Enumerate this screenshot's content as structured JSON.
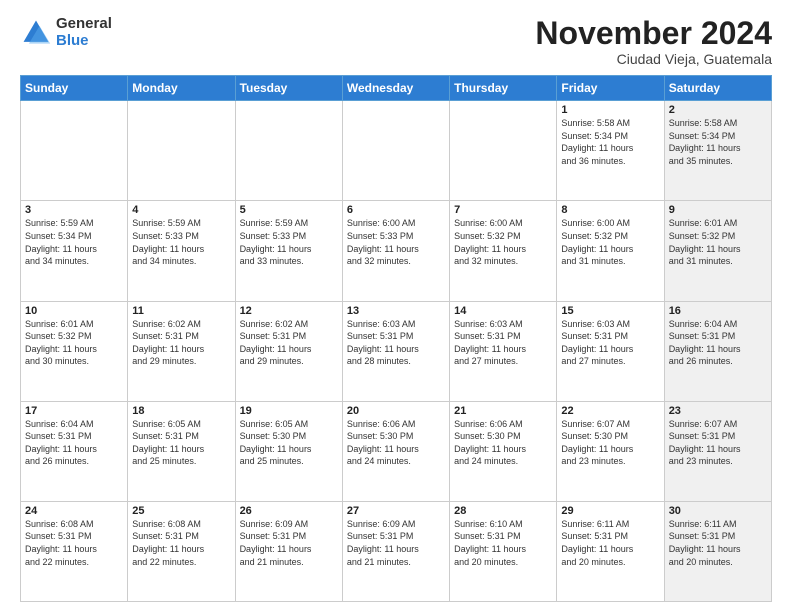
{
  "logo": {
    "general": "General",
    "blue": "Blue"
  },
  "header": {
    "month": "November 2024",
    "location": "Ciudad Vieja, Guatemala"
  },
  "weekdays": [
    "Sunday",
    "Monday",
    "Tuesday",
    "Wednesday",
    "Thursday",
    "Friday",
    "Saturday"
  ],
  "weeks": [
    [
      {
        "day": "",
        "info": "",
        "shaded": false
      },
      {
        "day": "",
        "info": "",
        "shaded": false
      },
      {
        "day": "",
        "info": "",
        "shaded": false
      },
      {
        "day": "",
        "info": "",
        "shaded": false
      },
      {
        "day": "",
        "info": "",
        "shaded": false
      },
      {
        "day": "1",
        "info": "Sunrise: 5:58 AM\nSunset: 5:34 PM\nDaylight: 11 hours\nand 36 minutes.",
        "shaded": false
      },
      {
        "day": "2",
        "info": "Sunrise: 5:58 AM\nSunset: 5:34 PM\nDaylight: 11 hours\nand 35 minutes.",
        "shaded": true
      }
    ],
    [
      {
        "day": "3",
        "info": "Sunrise: 5:59 AM\nSunset: 5:34 PM\nDaylight: 11 hours\nand 34 minutes.",
        "shaded": false
      },
      {
        "day": "4",
        "info": "Sunrise: 5:59 AM\nSunset: 5:33 PM\nDaylight: 11 hours\nand 34 minutes.",
        "shaded": false
      },
      {
        "day": "5",
        "info": "Sunrise: 5:59 AM\nSunset: 5:33 PM\nDaylight: 11 hours\nand 33 minutes.",
        "shaded": false
      },
      {
        "day": "6",
        "info": "Sunrise: 6:00 AM\nSunset: 5:33 PM\nDaylight: 11 hours\nand 32 minutes.",
        "shaded": false
      },
      {
        "day": "7",
        "info": "Sunrise: 6:00 AM\nSunset: 5:32 PM\nDaylight: 11 hours\nand 32 minutes.",
        "shaded": false
      },
      {
        "day": "8",
        "info": "Sunrise: 6:00 AM\nSunset: 5:32 PM\nDaylight: 11 hours\nand 31 minutes.",
        "shaded": false
      },
      {
        "day": "9",
        "info": "Sunrise: 6:01 AM\nSunset: 5:32 PM\nDaylight: 11 hours\nand 31 minutes.",
        "shaded": true
      }
    ],
    [
      {
        "day": "10",
        "info": "Sunrise: 6:01 AM\nSunset: 5:32 PM\nDaylight: 11 hours\nand 30 minutes.",
        "shaded": false
      },
      {
        "day": "11",
        "info": "Sunrise: 6:02 AM\nSunset: 5:31 PM\nDaylight: 11 hours\nand 29 minutes.",
        "shaded": false
      },
      {
        "day": "12",
        "info": "Sunrise: 6:02 AM\nSunset: 5:31 PM\nDaylight: 11 hours\nand 29 minutes.",
        "shaded": false
      },
      {
        "day": "13",
        "info": "Sunrise: 6:03 AM\nSunset: 5:31 PM\nDaylight: 11 hours\nand 28 minutes.",
        "shaded": false
      },
      {
        "day": "14",
        "info": "Sunrise: 6:03 AM\nSunset: 5:31 PM\nDaylight: 11 hours\nand 27 minutes.",
        "shaded": false
      },
      {
        "day": "15",
        "info": "Sunrise: 6:03 AM\nSunset: 5:31 PM\nDaylight: 11 hours\nand 27 minutes.",
        "shaded": false
      },
      {
        "day": "16",
        "info": "Sunrise: 6:04 AM\nSunset: 5:31 PM\nDaylight: 11 hours\nand 26 minutes.",
        "shaded": true
      }
    ],
    [
      {
        "day": "17",
        "info": "Sunrise: 6:04 AM\nSunset: 5:31 PM\nDaylight: 11 hours\nand 26 minutes.",
        "shaded": false
      },
      {
        "day": "18",
        "info": "Sunrise: 6:05 AM\nSunset: 5:31 PM\nDaylight: 11 hours\nand 25 minutes.",
        "shaded": false
      },
      {
        "day": "19",
        "info": "Sunrise: 6:05 AM\nSunset: 5:30 PM\nDaylight: 11 hours\nand 25 minutes.",
        "shaded": false
      },
      {
        "day": "20",
        "info": "Sunrise: 6:06 AM\nSunset: 5:30 PM\nDaylight: 11 hours\nand 24 minutes.",
        "shaded": false
      },
      {
        "day": "21",
        "info": "Sunrise: 6:06 AM\nSunset: 5:30 PM\nDaylight: 11 hours\nand 24 minutes.",
        "shaded": false
      },
      {
        "day": "22",
        "info": "Sunrise: 6:07 AM\nSunset: 5:30 PM\nDaylight: 11 hours\nand 23 minutes.",
        "shaded": false
      },
      {
        "day": "23",
        "info": "Sunrise: 6:07 AM\nSunset: 5:31 PM\nDaylight: 11 hours\nand 23 minutes.",
        "shaded": true
      }
    ],
    [
      {
        "day": "24",
        "info": "Sunrise: 6:08 AM\nSunset: 5:31 PM\nDaylight: 11 hours\nand 22 minutes.",
        "shaded": false
      },
      {
        "day": "25",
        "info": "Sunrise: 6:08 AM\nSunset: 5:31 PM\nDaylight: 11 hours\nand 22 minutes.",
        "shaded": false
      },
      {
        "day": "26",
        "info": "Sunrise: 6:09 AM\nSunset: 5:31 PM\nDaylight: 11 hours\nand 21 minutes.",
        "shaded": false
      },
      {
        "day": "27",
        "info": "Sunrise: 6:09 AM\nSunset: 5:31 PM\nDaylight: 11 hours\nand 21 minutes.",
        "shaded": false
      },
      {
        "day": "28",
        "info": "Sunrise: 6:10 AM\nSunset: 5:31 PM\nDaylight: 11 hours\nand 20 minutes.",
        "shaded": false
      },
      {
        "day": "29",
        "info": "Sunrise: 6:11 AM\nSunset: 5:31 PM\nDaylight: 11 hours\nand 20 minutes.",
        "shaded": false
      },
      {
        "day": "30",
        "info": "Sunrise: 6:11 AM\nSunset: 5:31 PM\nDaylight: 11 hours\nand 20 minutes.",
        "shaded": true
      }
    ]
  ]
}
